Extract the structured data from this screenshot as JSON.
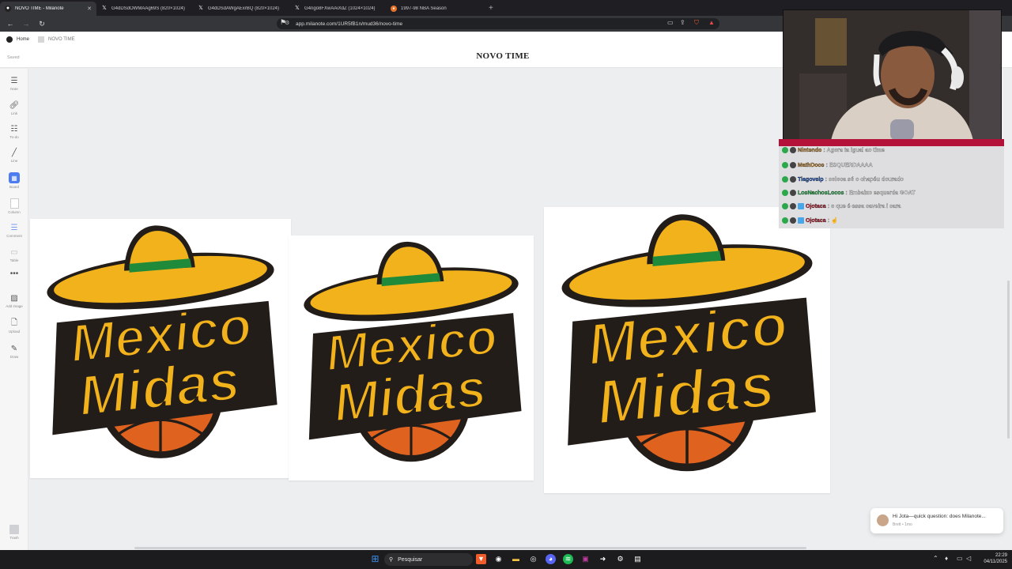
{
  "browser": {
    "tabs": [
      {
        "title": "NOVO TIME - Milanote",
        "icon": "milanote-icon",
        "active": true
      },
      {
        "title": "G4dDSdOWMAAg69S (820×1024)",
        "icon": "x-icon",
        "active": false
      },
      {
        "title": "G4dDSdAWgAExrBQ (820×1024)",
        "icon": "x-icon",
        "active": false
      },
      {
        "title": "G4ngo8FXwAAiXdZ (1024×1024)",
        "icon": "x-icon",
        "active": false
      },
      {
        "title": "1997-98 NBA Season",
        "icon": "basketball-reference-icon",
        "active": false
      }
    ],
    "new_tab": "+",
    "url": "app.milanote.com/1UR5fB1n/mud36/novo-time"
  },
  "app": {
    "breadcrumb": {
      "home": "Home",
      "current": "NOVO TIME"
    },
    "status": "Saved",
    "board_title": "NOVO TIME",
    "tools": [
      {
        "name": "note",
        "label": "Note",
        "icon": "note-icon"
      },
      {
        "name": "link",
        "label": "Link",
        "icon": "link-icon"
      },
      {
        "name": "todo",
        "label": "To-do",
        "icon": "todo-icon"
      },
      {
        "name": "line",
        "label": "Line",
        "icon": "line-icon"
      },
      {
        "name": "board",
        "label": "Board",
        "icon": "board-icon"
      },
      {
        "name": "column",
        "label": "Column",
        "icon": "column-icon"
      },
      {
        "name": "comment",
        "label": "Comment",
        "icon": "comment-icon"
      },
      {
        "name": "table",
        "label": "Table",
        "icon": "table-icon"
      },
      {
        "name": "more",
        "label": "",
        "icon": "more-icon"
      },
      {
        "name": "add-image",
        "label": "Add image",
        "icon": "image-icon"
      },
      {
        "name": "upload",
        "label": "Upload",
        "icon": "upload-icon"
      },
      {
        "name": "draw",
        "label": "Draw",
        "icon": "pen-icon"
      }
    ],
    "trash": "Trash"
  },
  "logos": {
    "line1": "Mexico",
    "line2": "Midas"
  },
  "chat": [
    {
      "user": "Nintendo",
      "message": "Agora ta igual ao time",
      "color": "#e9a03b"
    },
    {
      "user": "MathDoce",
      "message": "ESQUERDAAAA",
      "color": "#e9a03b"
    },
    {
      "user": "Tiagovelp",
      "message": "coloca só o chapéu dourado",
      "color": "#2d6cdf"
    },
    {
      "user": "LosNachosLocos",
      "message": "Embaixo esquerda GOAT",
      "color": "#2fd35a"
    },
    {
      "user": "Ojotaca",
      "message": "o que é essa caveira i cara",
      "color": "#e0243c"
    },
    {
      "user": "Ojotaca",
      "message": "☝",
      "color": "#e0243c"
    }
  ],
  "toast": {
    "message": "Hi Jota—quick question: does Milanote...",
    "meta": "Brett • 1mo"
  },
  "taskbar": {
    "search_label": "Pesquisar",
    "time": "22:29",
    "date": "04/11/2025"
  },
  "colors": {
    "gold": "#f2b21b",
    "dark_outline": "#231d1a",
    "ball_orange": "#e0621f",
    "hat_band": "#1f8a3a",
    "accent_live": "#b5123a"
  }
}
